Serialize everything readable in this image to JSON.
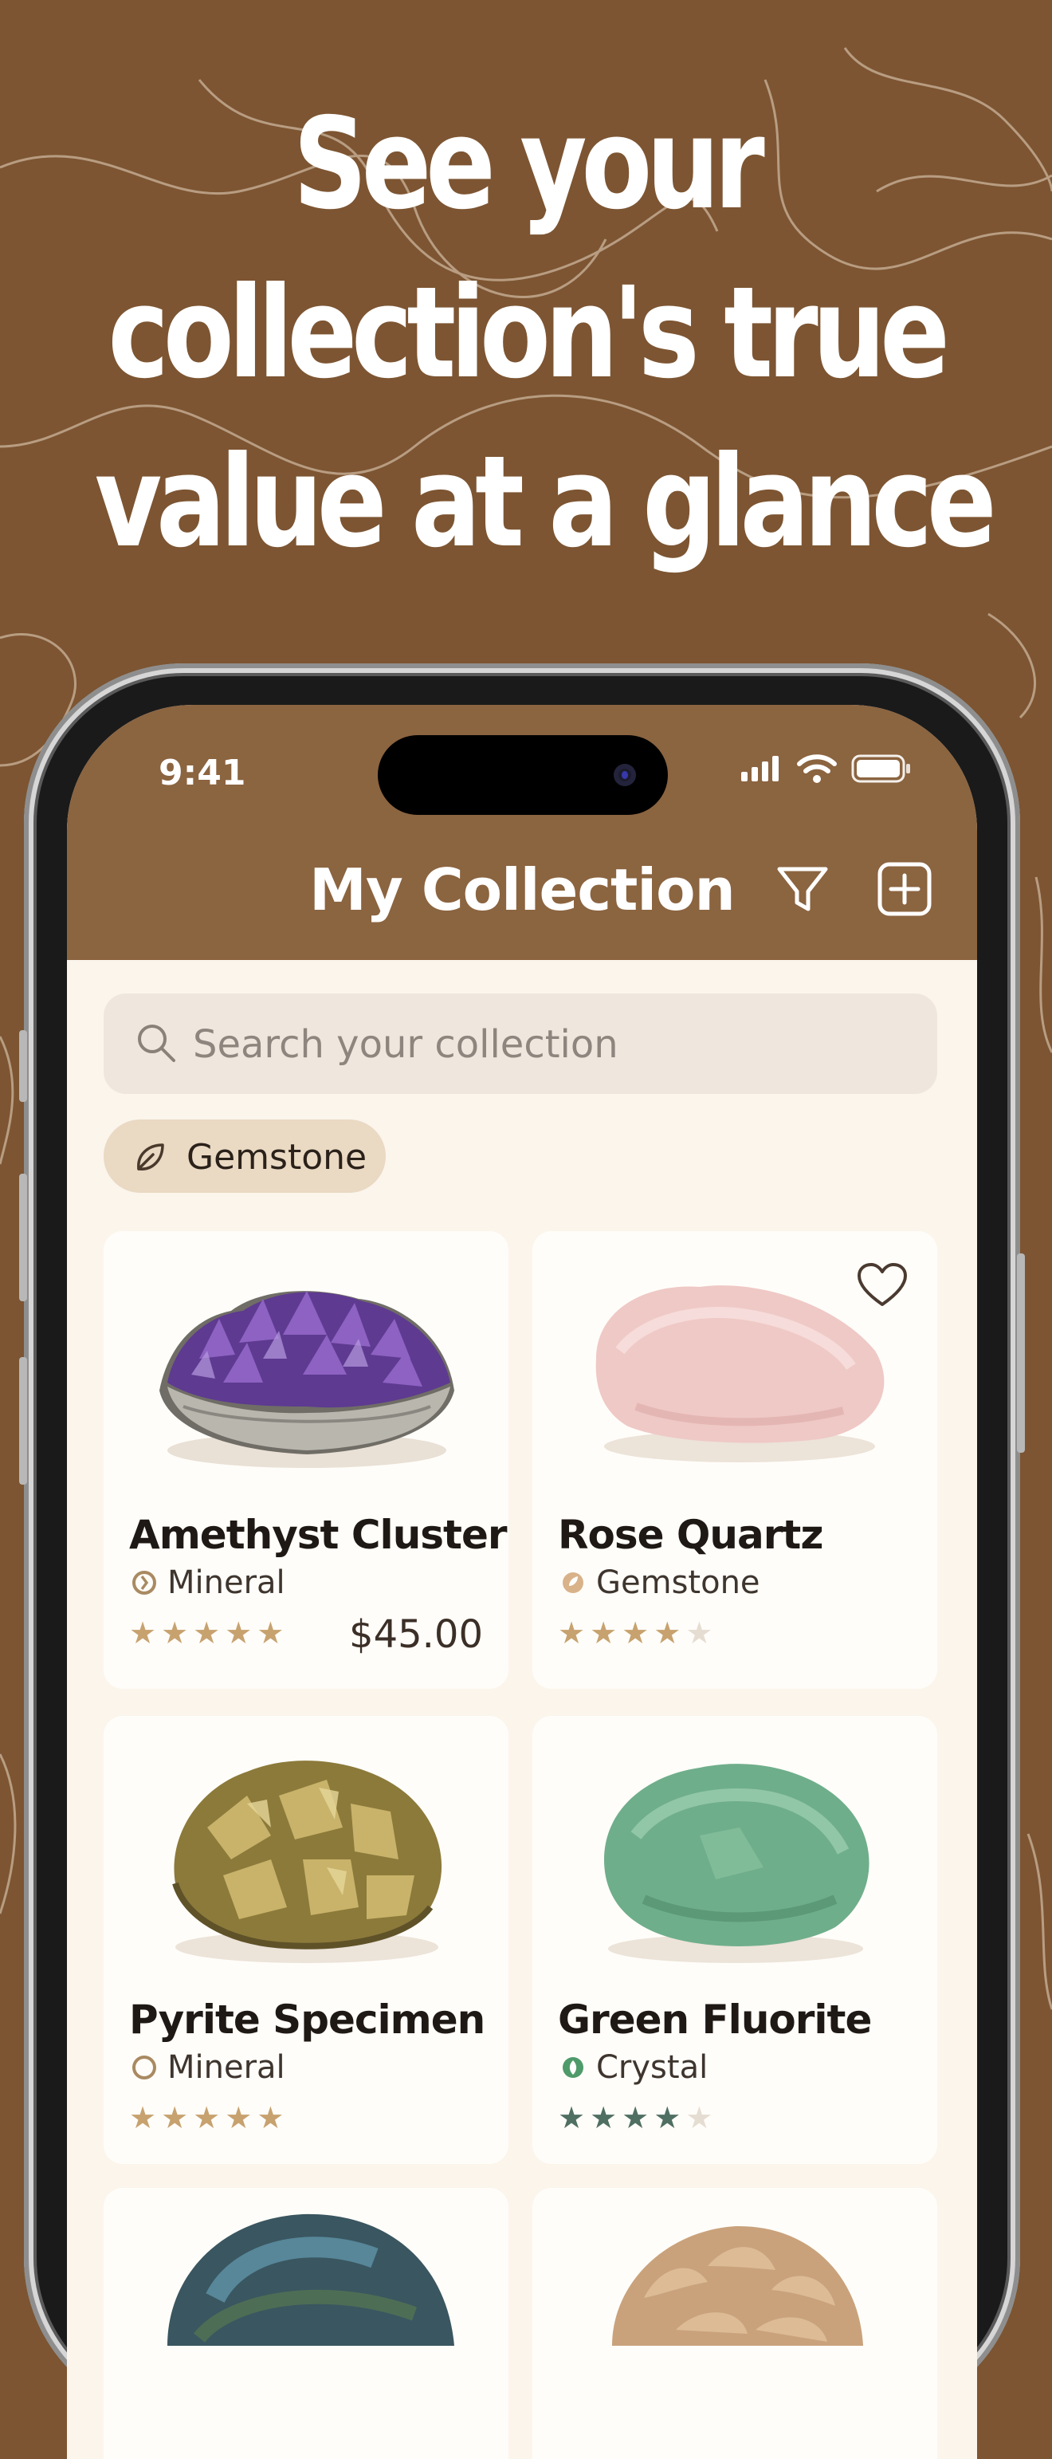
{
  "headline": {
    "lines": [
      "See your",
      "collection's true",
      "value at a glance"
    ]
  },
  "status_bar": {
    "time": "9:41",
    "icons": [
      "signal-icon",
      "wifi-icon",
      "battery-icon"
    ]
  },
  "header": {
    "title": "My Collection",
    "filter_icon": "filter-icon",
    "add_icon": "add-icon"
  },
  "search": {
    "placeholder": "Search your collection"
  },
  "filter_chip": {
    "label": "Gemstone"
  },
  "items": [
    {
      "name": "Amethyst Cluster",
      "type": "Mineral",
      "rating": 5,
      "price": "$45.00",
      "favorite": false
    },
    {
      "name": "Rose Quartz",
      "type": "Gemstone",
      "rating": 4,
      "price": "",
      "favorite": true
    },
    {
      "name": "Pyrite Specimen",
      "type": "Mineral",
      "rating": 5,
      "price": "",
      "favorite": false
    },
    {
      "name": "Green Fluorite",
      "type": "Crystal",
      "rating": 4,
      "price": "",
      "favorite": false
    }
  ],
  "colors": {
    "background": "#7d5532",
    "header": "#8b6440",
    "screen": "#fbf5ec",
    "star_gold": "#c7a26f",
    "star_green": "#4f6f63",
    "star_empty": "#e6ddd2"
  }
}
